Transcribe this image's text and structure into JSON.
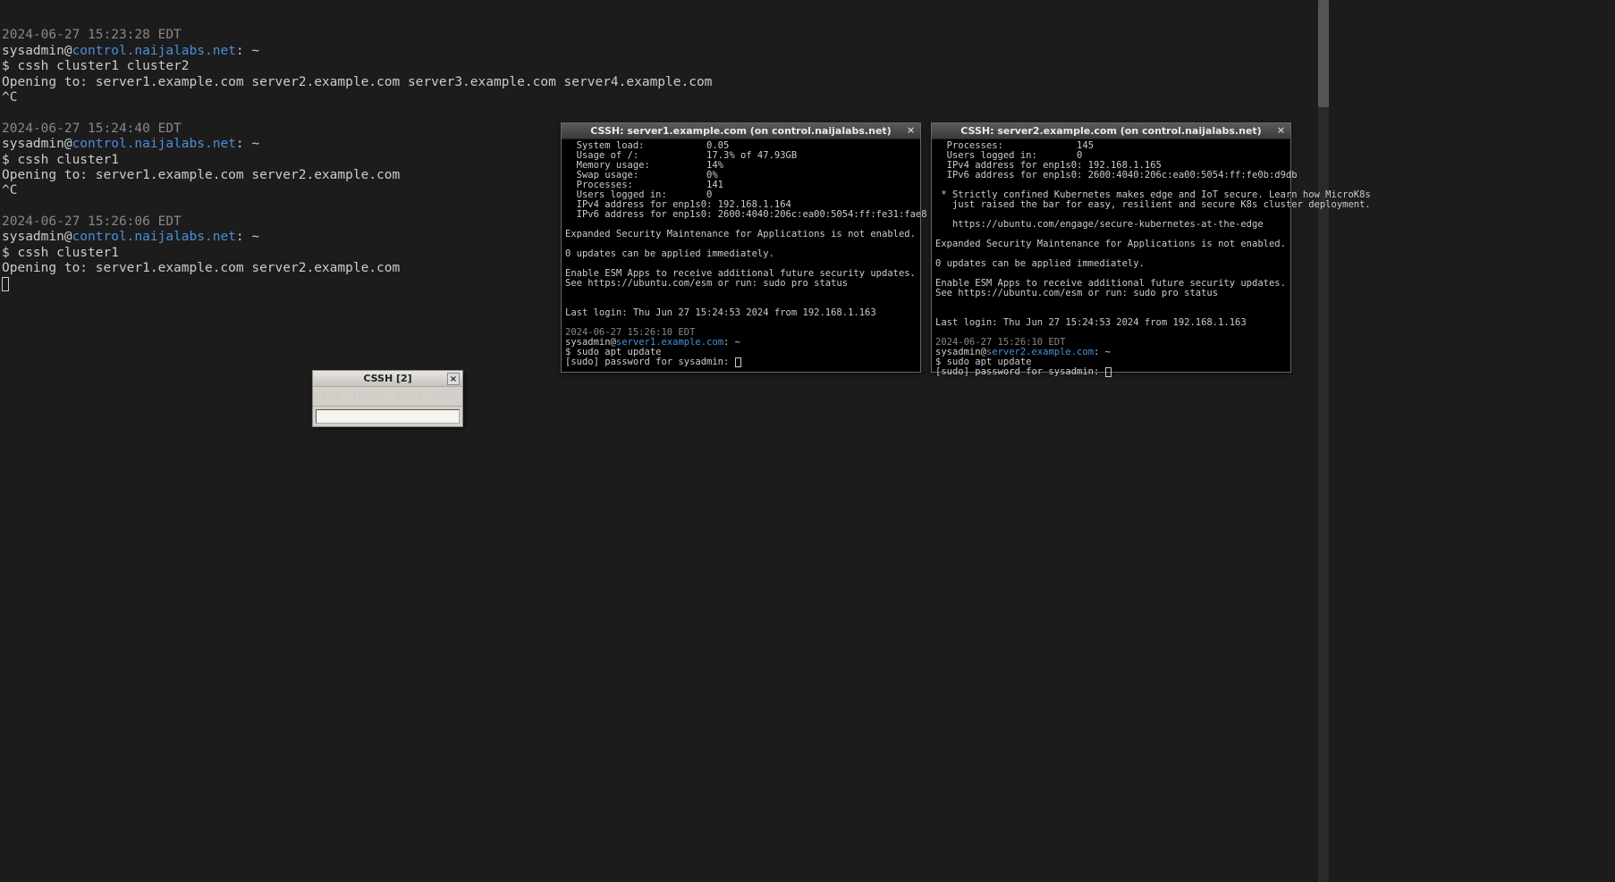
{
  "main_terminal": {
    "blocks": [
      {
        "ts": "2024-06-27 15:23:28 EDT",
        "user": "sysadmin",
        "host": "control.naijalabs.net",
        "path": "~",
        "cmd": "cssh cluster1 cluster2",
        "out": "Opening to: server1.example.com server2.example.com server3.example.com server4.example.com",
        "intr": "^C"
      },
      {
        "ts": "2024-06-27 15:24:40 EDT",
        "user": "sysadmin",
        "host": "control.naijalabs.net",
        "path": "~",
        "cmd": "cssh cluster1",
        "out": "Opening to: server1.example.com server2.example.com",
        "intr": "^C"
      },
      {
        "ts": "2024-06-27 15:26:06 EDT",
        "user": "sysadmin",
        "host": "control.naijalabs.net",
        "path": "~",
        "cmd": "cssh cluster1",
        "out": "Opening to: server1.example.com server2.example.com",
        "intr": ""
      }
    ]
  },
  "ssh1": {
    "title": "CSSH: server1.example.com (on control.naijalabs.net)",
    "stats": [
      "  System load:           0.05",
      "  Usage of /:            17.3% of 47.93GB",
      "  Memory usage:          14%",
      "  Swap usage:            0%",
      "  Processes:             141",
      "  Users logged in:       0",
      "  IPv4 address for enp1s0: 192.168.1.164",
      "  IPv6 address for enp1s0: 2600:4040:206c:ea00:5054:ff:fe31:fae8"
    ],
    "esm1": "Expanded Security Maintenance for Applications is not enabled.",
    "updates": "0 updates can be applied immediately.",
    "esm2a": "Enable ESM Apps to receive additional future security updates.",
    "esm2b": "See https://ubuntu.com/esm or run: sudo pro status",
    "lastlogin": "Last login: Thu Jun 27 15:24:53 2024 from 192.168.1.163",
    "ts": "2024-06-27 15:26:10 EDT",
    "user": "sysadmin",
    "host": "server1.example.com",
    "path": "~",
    "cmd": "sudo apt update",
    "sudo": "[sudo] password for sysadmin: "
  },
  "ssh2": {
    "title": "CSSH: server2.example.com (on control.naijalabs.net)",
    "stats": [
      "  Processes:             145",
      "  Users logged in:       0",
      "  IPv4 address for enp1s0: 192.168.1.165",
      "  IPv6 address for enp1s0: 2600:4040:206c:ea00:5054:ff:fe0b:d9db"
    ],
    "k8s1": " * Strictly confined Kubernetes makes edge and IoT secure. Learn how MicroK8s",
    "k8s2": "   just raised the bar for easy, resilient and secure K8s cluster deployment.",
    "k8surl": "   https://ubuntu.com/engage/secure-kubernetes-at-the-edge",
    "esm1": "Expanded Security Maintenance for Applications is not enabled.",
    "updates": "0 updates can be applied immediately.",
    "esm2a": "Enable ESM Apps to receive additional future security updates.",
    "esm2b": "See https://ubuntu.com/esm or run: sudo pro status",
    "lastlogin": "Last login: Thu Jun 27 15:24:53 2024 from 192.168.1.163",
    "ts": "2024-06-27 15:26:10 EDT",
    "user": "sysadmin",
    "host": "server2.example.com",
    "path": "~",
    "cmd": "sudo apt update",
    "sudo": "[sudo] password for sysadmin: "
  },
  "cssh": {
    "title": "CSSH [2]",
    "menu": {
      "file": "File",
      "hosts": "Hosts",
      "send": "Send",
      "help": "Help"
    },
    "input_value": ""
  }
}
